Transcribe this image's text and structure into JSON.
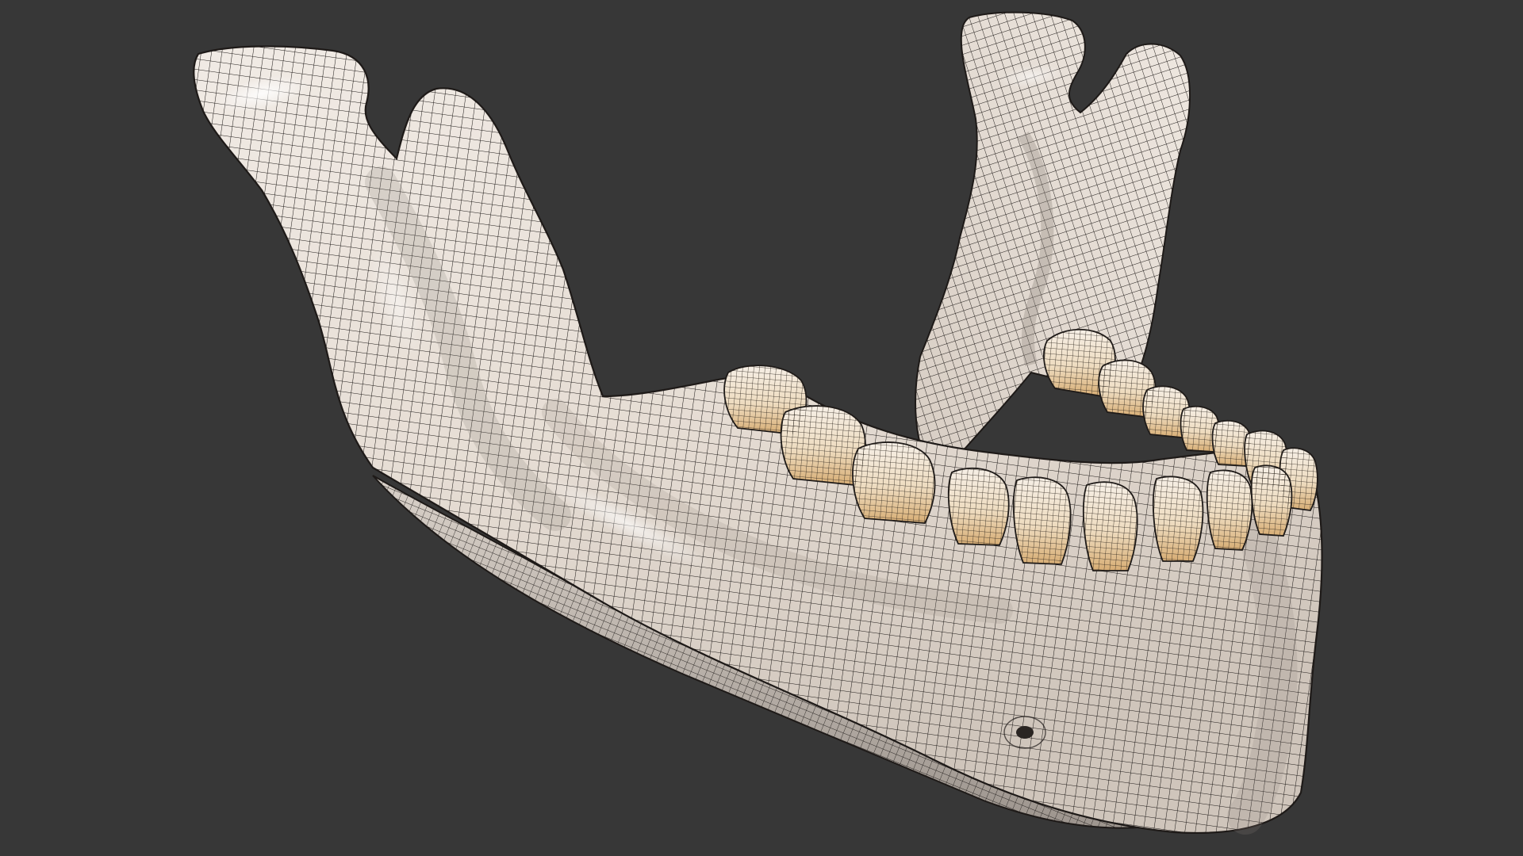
{
  "scene": {
    "subject": "mandible-wireframe-model",
    "background_color": "#373737",
    "bone_color": "#ece4dc",
    "bone_shadow_color": "#b9b0a7",
    "tooth_color": "#f2e3c6",
    "tooth_root_color": "#d9b17a",
    "wire_color": "#1e1a18",
    "highlight_color": "#ffffff"
  }
}
